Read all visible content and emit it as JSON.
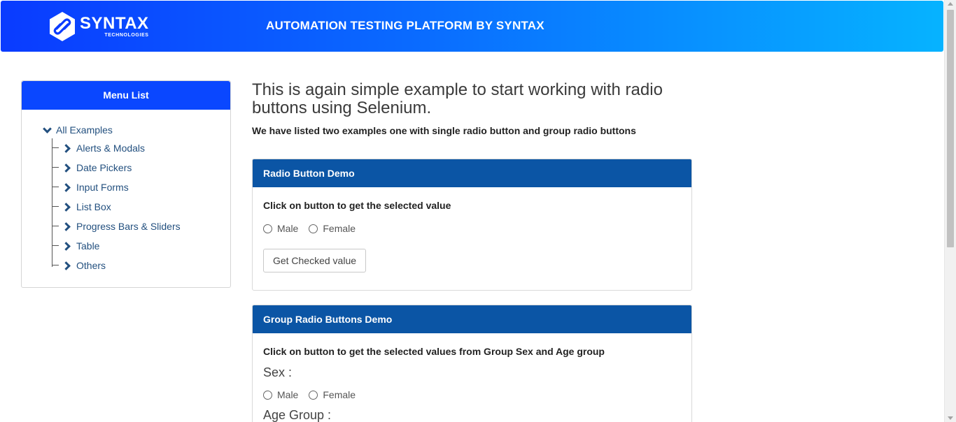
{
  "header": {
    "logo_main": "SYNTAX",
    "logo_sub": "TECHNOLOGIES",
    "title": "AUTOMATION TESTING PLATFORM BY SYNTAX"
  },
  "sidebar": {
    "title": "Menu List",
    "root": "All Examples",
    "items": [
      {
        "label": "Alerts & Modals"
      },
      {
        "label": "Date Pickers"
      },
      {
        "label": "Input Forms"
      },
      {
        "label": "List Box"
      },
      {
        "label": "Progress Bars & Sliders"
      },
      {
        "label": "Table"
      },
      {
        "label": "Others"
      }
    ]
  },
  "main": {
    "title": "This is again simple example to start working with radio buttons using Selenium.",
    "subtitle": "We have listed two examples one with single radio button and group radio buttons",
    "panel1": {
      "title": "Radio Button Demo",
      "instruction": "Click on button to get the selected value",
      "options": [
        "Male",
        "Female"
      ],
      "button_label": "Get Checked value"
    },
    "panel2": {
      "title": "Group Radio Buttons Demo",
      "instruction": "Click on button to get the selected values from Group Sex and Age group",
      "sex_label": "Sex :",
      "sex_options": [
        "Male",
        "Female"
      ],
      "age_label": "Age Group :"
    }
  },
  "colors": {
    "header_gradient_start": "#0a3bff",
    "header_gradient_end": "#06b3ff",
    "sidebar_header": "#0a47ff",
    "panel_header": "#0b55a5",
    "link_text": "#23507f"
  }
}
